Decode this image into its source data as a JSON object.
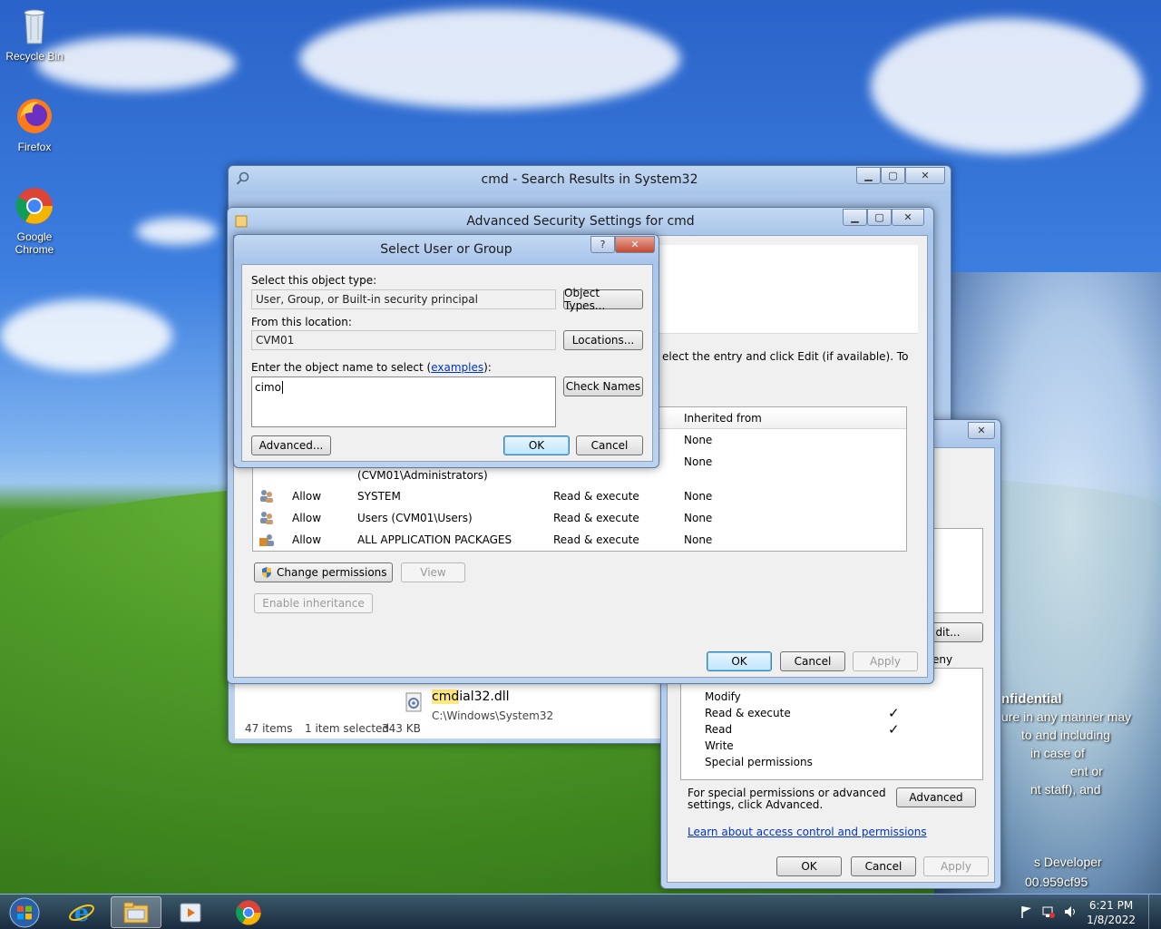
{
  "desktop": {
    "icons": [
      {
        "label": "Recycle Bin"
      },
      {
        "label": "Firefox"
      },
      {
        "label": "Google Chrome"
      }
    ],
    "wallpaper_text": {
      "line1": "nfidential",
      "line2": "ure in any manner may",
      "line3": "to and including",
      "line4": "in case of",
      "line5": "ent or",
      "line6": "nt staff), and",
      "line7": "s Developer",
      "line8": "00.959cf95"
    }
  },
  "explorer": {
    "title": "cmd - Search Results in System32",
    "file_name": "cmdial32.dll",
    "file_name_highlight": "cmd",
    "file_name_rest": "ial32.dll",
    "file_path": "C:\\Windows\\System32",
    "status_items": "47 items",
    "status_selected": "1 item selected",
    "status_size": "343 KB"
  },
  "advanced_security": {
    "title": "Advanced Security Settings for cmd",
    "instruction_fragment": "elect the entry and click Edit (if available). To",
    "col_inherited": "Inherited from",
    "rows": [
      {
        "type": "",
        "principal": "",
        "access": "",
        "inherited": "None"
      },
      {
        "type": "",
        "principal": "(CVM01\\Administrators)",
        "access": "",
        "inherited": "None"
      },
      {
        "type": "Allow",
        "principal": "SYSTEM",
        "access": "Read & execute",
        "inherited": "None"
      },
      {
        "type": "Allow",
        "principal": "Users (CVM01\\Users)",
        "access": "Read & execute",
        "inherited": "None"
      },
      {
        "type": "Allow",
        "principal": "ALL APPLICATION PACKAGES",
        "access": "Read & execute",
        "inherited": "None"
      }
    ],
    "change_permissions": "Change permissions",
    "view": "View",
    "enable_inheritance": "Enable inheritance",
    "ok": "OK",
    "cancel": "Cancel",
    "apply": "Apply"
  },
  "properties": {
    "edit_fragment": "dit...",
    "deny_fragment": "eny",
    "perms": [
      {
        "name": "Modify",
        "allow": ""
      },
      {
        "name": "Read & execute",
        "allow": "✓"
      },
      {
        "name": "Read",
        "allow": "✓"
      },
      {
        "name": "Write",
        "allow": ""
      },
      {
        "name": "Special permissions",
        "allow": ""
      }
    ],
    "special_note": "For special permissions or advanced settings, click Advanced.",
    "advanced": "Advanced",
    "learn_link": "Learn about access control and permissions",
    "ok": "OK",
    "cancel": "Cancel",
    "apply": "Apply"
  },
  "select_dialog": {
    "title": "Select User or Group",
    "help": "?",
    "object_type_label": "Select this object type:",
    "object_type_value": "User, Group, or Built-in security principal",
    "object_types_btn": "Object Types...",
    "location_label": "From this location:",
    "location_value": "CVM01",
    "locations_btn": "Locations...",
    "enter_label": "Enter the object name to select (",
    "examples_link": "examples",
    "enter_label_end": "):",
    "object_name_value": "cimo",
    "check_names_btn": "Check Names",
    "advanced_btn": "Advanced...",
    "ok": "OK",
    "cancel": "Cancel"
  },
  "taskbar": {
    "time": "6:21 PM",
    "date": "1/8/2022"
  }
}
